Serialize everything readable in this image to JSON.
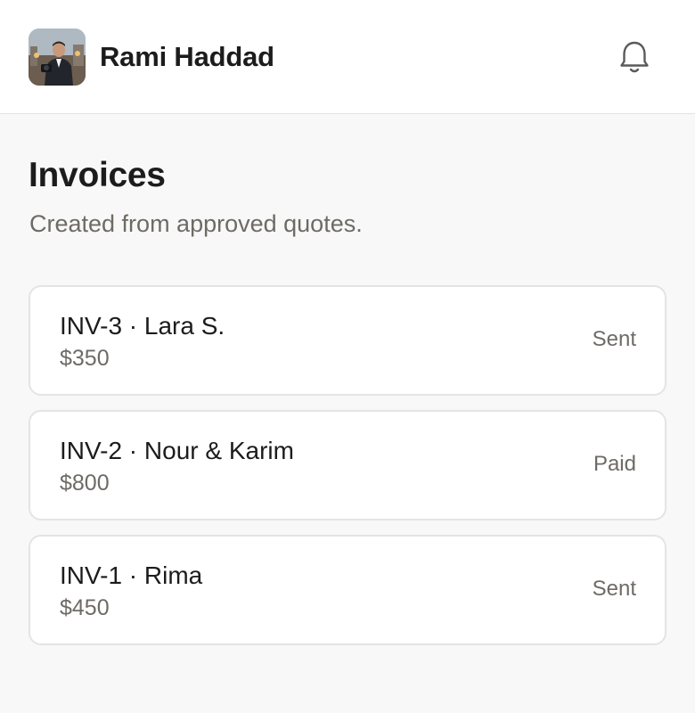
{
  "header": {
    "user_name": "Rami Haddad",
    "avatar_icon": "user-photo",
    "notification_icon": "bell-icon"
  },
  "page": {
    "title": "Invoices",
    "subtitle": "Created from approved quotes."
  },
  "invoices": [
    {
      "title": "INV-3 · Lara S.",
      "amount": "$350",
      "status": "Sent"
    },
    {
      "title": "INV-2 · Nour & Karim",
      "amount": "$800",
      "status": "Paid"
    },
    {
      "title": "INV-1 · Rima",
      "amount": "$450",
      "status": "Sent"
    }
  ],
  "colors": {
    "background": "#f8f8f8",
    "card": "#ffffff",
    "border": "#e4e4e4",
    "text_primary": "#1c1c1c",
    "text_secondary": "#6e6b66"
  }
}
